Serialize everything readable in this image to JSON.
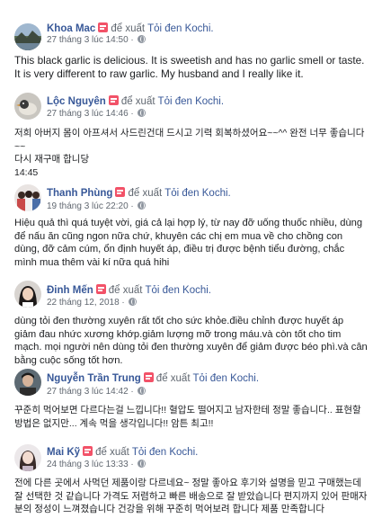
{
  "recommend_text": "để xuất",
  "page_name": "Tỏi đen Kochi.",
  "reviews": [
    {
      "name": "Khoa Mac",
      "time": "27 tháng 3 lúc 14:50 ·",
      "text": "This black garlic is delicious. It is sweetish and has no garlic smell or taste. It is very different to raw garlic. My husband and I really like it.",
      "avatar": "avatar-landscape"
    },
    {
      "name": "Lộc Nguyên",
      "time": "27 tháng 3 lúc 14:46 ·",
      "text": "저희 아버지 몸이 아프셔서 사드린건대 드시고 기력 회복하셨어요~~^^ 완전 너무 좋습니다~~\n다시 재구매 합니당\n14:45",
      "avatar": "avatar-bird"
    },
    {
      "name": "Thanh Phùng",
      "time": "19 tháng 3 lúc 22:20 ·",
      "text": "Hiệu quả thì quá tuyệt vời, giá cả lại hợp lý, từ nay đỡ uống thuốc nhiều, dùng để nấu ăn cũng ngon nữa chứ, khuyên các chị em mua về cho chồng con dùng, đỡ cảm cúm, ổn định huyết áp, điều trị được bệnh tiểu đường, chắc mình mua thêm vài kí nữa quá hihi",
      "avatar": "avatar-group"
    },
    {
      "name": "Đinh Mến",
      "time": "22 tháng 12, 2018 ·",
      "text": "dùng tỏi đen thường xuyên rất tốt cho sức khỏe.điều chỉnh được huyết áp giảm đau nhức xương khớp.giảm lượng mỡ trong máu.và còn tốt cho tim mạch. mọi người nên dùng tỏi đen thường xuyên để giảm được béo phì.và cân bằng cuộc sống tốt hơn.",
      "avatar": "avatar-woman"
    },
    {
      "name": "Nguyễn Trần Trung",
      "time": "27 tháng 3 lúc 14:42 ·",
      "text": "꾸준히 먹어보면 다르다는걸 느낍니다!! 혈압도 떨어지고 남자한테 정말 좋습니다.. 표현할 방법은 없지만... 계속 먹을 생각입니다!! 암튼 최고!!",
      "avatar": "avatar-man"
    },
    {
      "name": "Mai Kỹ",
      "time": "24 tháng 3 lúc 13:33 ·",
      "text": "전에 다른 곳에서 사먹던 제품이랑 다르네요~ 정말 좋아요 후기와 설명을 믿고 구매했는데 잘 선택한 것 같습니다 가격도 저렴하고 빠른 배송으로 잘 받았습니다 편지까지 있어 판매자분의 정성이 느껴졌습니다 건강을 위해 꾸준히 먹어보려 합니다 제품 만족합니다",
      "avatar": "avatar-girl"
    }
  ]
}
